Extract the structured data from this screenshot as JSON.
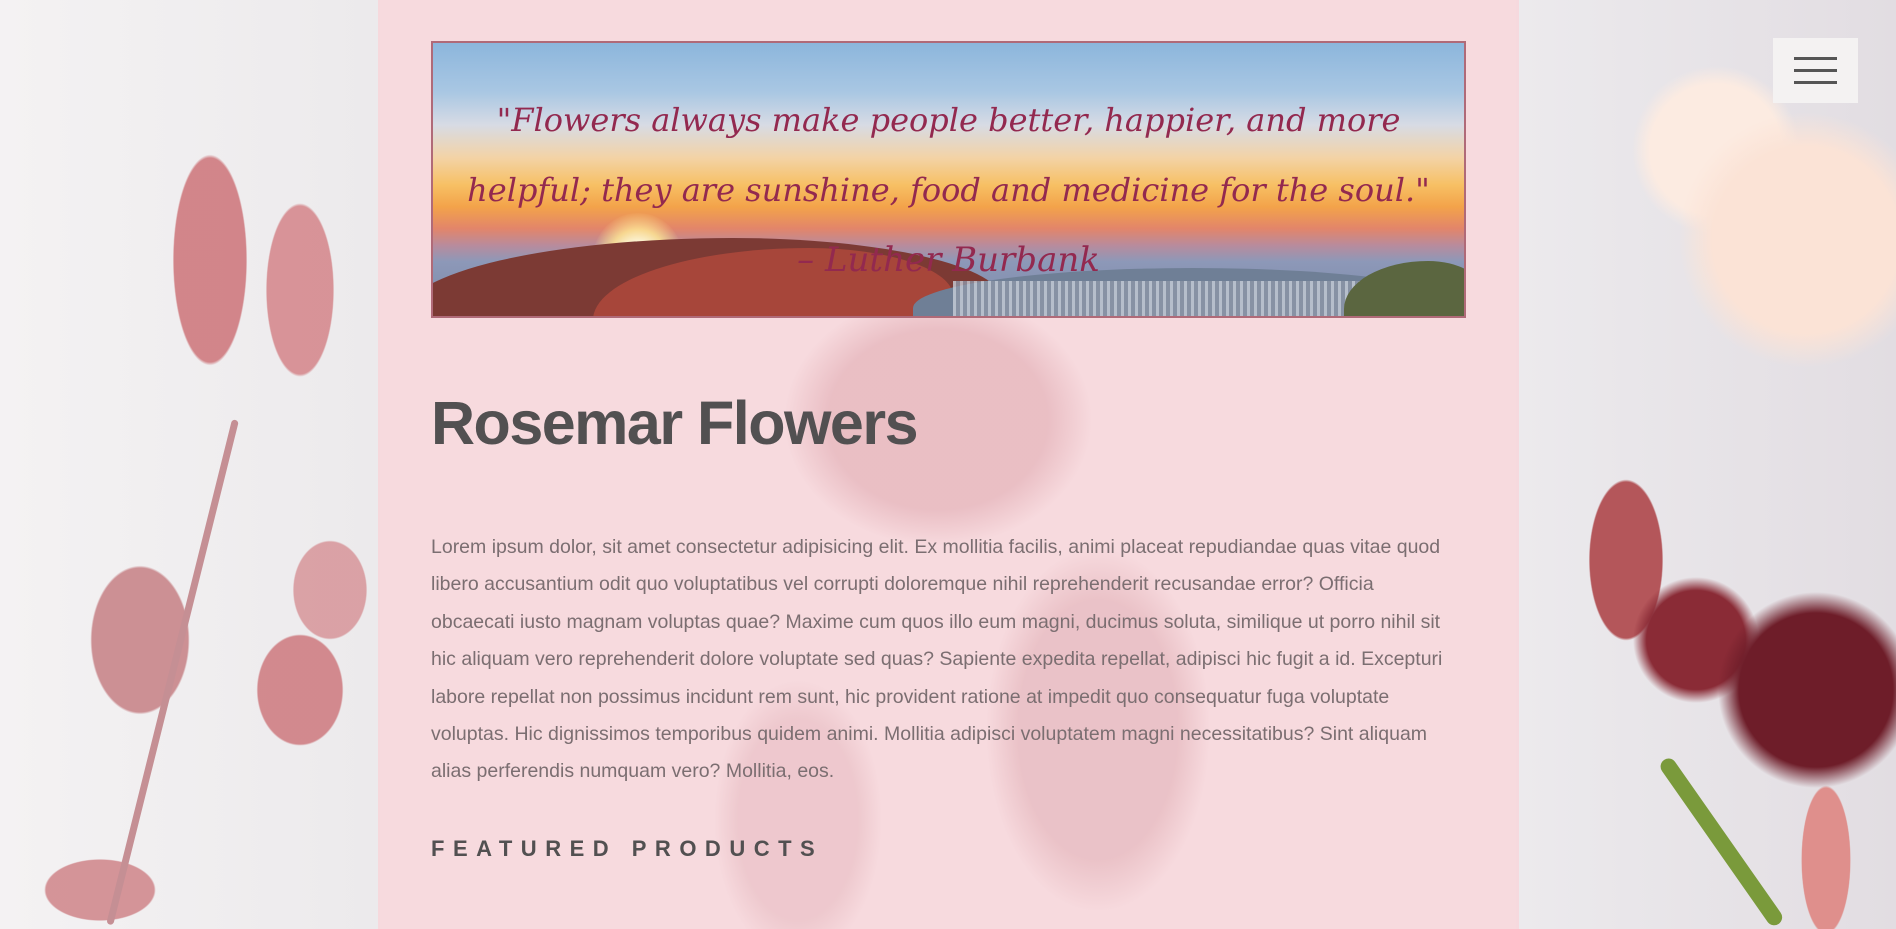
{
  "banner": {
    "quote": "\"Flowers always make people better, happier, and more helpful; they are sunshine, food and medicine for the soul.\"",
    "author": "– Luther Burbank"
  },
  "page_title": "Rosemar Flowers",
  "body_text": "Lorem ipsum dolor, sit amet consectetur adipisicing elit. Ex mollitia facilis, animi placeat repudiandae quas vitae quod libero accusantium odit quo voluptatibus vel corrupti doloremque nihil reprehenderit recusandae error? Officia obcaecati iusto magnam voluptas quae? Maxime cum quos illo eum magni, ducimus soluta, similique ut porro nihil sit hic aliquam vero reprehenderit dolore voluptate sed quas? Sapiente expedita repellat, adipisci hic fugit a id. Excepturi labore repellat non possimus incidunt rem sunt, hic provident ratione at impedit quo consequatur fuga voluptate voluptas. Hic dignissimos temporibus quidem animi. Mollitia adipisci voluptatem magni necessitatibus? Sint aliquam alias perferendis numquam vero? Mollitia, eos.",
  "section_heading": "FEATURED PRODUCTS",
  "menu": {
    "icon": "hamburger-menu-icon"
  },
  "colors": {
    "quote_text": "#93294f",
    "title_text": "#525051",
    "body_text": "#7b6e71",
    "panel_bg": "#f7d7dc"
  }
}
